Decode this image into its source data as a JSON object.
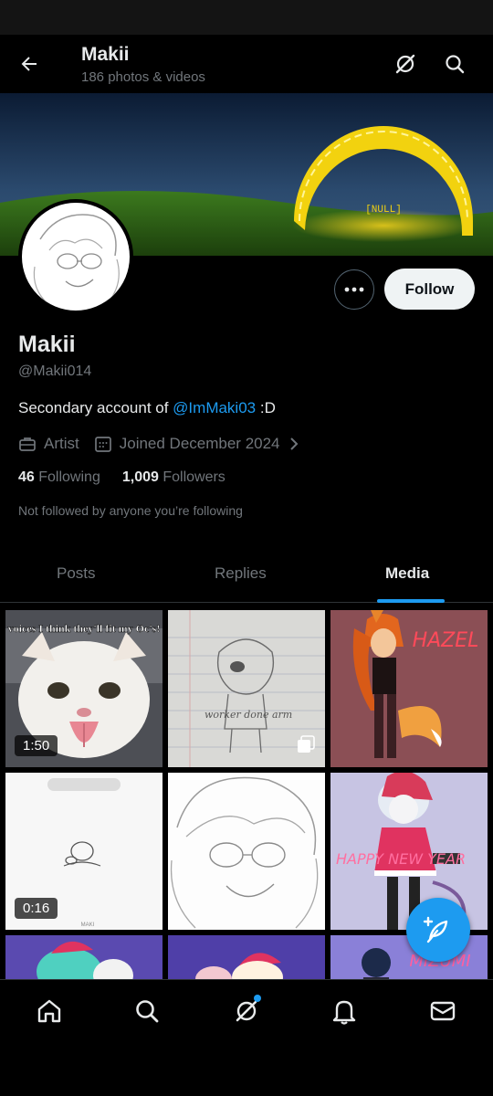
{
  "header": {
    "title": "Makii",
    "subtitle": "186 photos & videos"
  },
  "banner": {
    "label": "[NULL]"
  },
  "profile": {
    "name": "Makii",
    "handle": "@Makii014",
    "bio_prefix": "Secondary account of ",
    "bio_mention": "@ImMaki03",
    "bio_suffix": " :D",
    "category": "Artist",
    "joined": "Joined December 2024",
    "following_count": "46",
    "following_label": "Following",
    "followers_count": "1,009",
    "followers_label": "Followers",
    "not_followed_text": "Not followed by anyone you’re following",
    "follow_label": "Follow"
  },
  "tabs": [
    {
      "label": "Posts",
      "active": false
    },
    {
      "label": "Replies",
      "active": false
    },
    {
      "label": "Media",
      "active": true
    }
  ],
  "media": [
    {
      "caption": "voices I think they'll fit my Oc's!",
      "duration": "1:50",
      "type": "video"
    },
    {
      "caption": "worker done arm",
      "type": "multi-image"
    },
    {
      "caption": "HAZEL",
      "type": "image"
    },
    {
      "caption": "MAKI",
      "duration": "0:16",
      "type": "video"
    },
    {
      "caption": "",
      "type": "image"
    },
    {
      "caption": "HAPPY NEW YEAR",
      "type": "image"
    },
    {
      "caption": "",
      "type": "image"
    },
    {
      "caption": "",
      "type": "image"
    },
    {
      "caption": "MIZUMI",
      "type": "image"
    }
  ],
  "colors": {
    "accent": "#1d9bf0",
    "background": "#000000",
    "secondary_text": "#71767b"
  },
  "nav": {
    "items": [
      "home-icon",
      "search-icon",
      "grok-icon",
      "bell-icon",
      "mail-icon"
    ]
  }
}
